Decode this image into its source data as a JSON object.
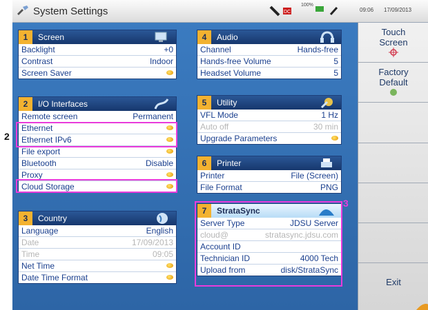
{
  "header": {
    "title": "System Settings",
    "battery_label": "100%",
    "time": "09:06",
    "date": "17/09/2013"
  },
  "callouts": {
    "left": "2",
    "right": "3"
  },
  "screen": {
    "num": "1",
    "title": "Screen",
    "rows": [
      {
        "label": "Backlight",
        "value": "+0"
      },
      {
        "label": "Contrast",
        "value": "Indoor"
      },
      {
        "label": "Screen Saver",
        "value": ""
      }
    ]
  },
  "io": {
    "num": "2",
    "title": "I/O Interfaces",
    "rows": [
      {
        "label": "Remote screen",
        "value": "Permanent"
      },
      {
        "label": "Ethernet",
        "value": ""
      },
      {
        "label": "Ethernet IPv6",
        "value": ""
      },
      {
        "label": "File export",
        "value": ""
      },
      {
        "label": "Bluetooth",
        "value": "Disable"
      },
      {
        "label": "Proxy",
        "value": ""
      },
      {
        "label": "Cloud Storage",
        "value": ""
      }
    ]
  },
  "country": {
    "num": "3",
    "title": "Country",
    "rows": [
      {
        "label": "Language",
        "value": "English"
      },
      {
        "label": "Date",
        "value": "17/09/2013"
      },
      {
        "label": "Time",
        "value": "09:05"
      },
      {
        "label": "Net Time",
        "value": ""
      },
      {
        "label": "Date Time Format",
        "value": ""
      }
    ]
  },
  "audio": {
    "num": "4",
    "title": "Audio",
    "rows": [
      {
        "label": "Channel",
        "value": "Hands-free"
      },
      {
        "label": "Hands-free Volume",
        "value": "5"
      },
      {
        "label": "Headset Volume",
        "value": "5"
      }
    ]
  },
  "utility": {
    "num": "5",
    "title": "Utility",
    "rows": [
      {
        "label": "VFL Mode",
        "value": "1 Hz"
      },
      {
        "label": "Auto off",
        "value": "30 min"
      },
      {
        "label": "Upgrade Parameters",
        "value": ""
      }
    ]
  },
  "printer": {
    "num": "6",
    "title": "Printer",
    "rows": [
      {
        "label": "Printer",
        "value": "File (Screen)"
      },
      {
        "label": "File Format",
        "value": "PNG"
      }
    ]
  },
  "stratasync": {
    "num": "7",
    "title": "StrataSync",
    "rows": [
      {
        "label": "Server Type",
        "value": "JDSU Server"
      },
      {
        "label": "cloud@",
        "value": "stratasync.jdsu.com"
      },
      {
        "label": "Account ID",
        "value": ""
      },
      {
        "label": "Technician ID",
        "value": "4000 Tech"
      },
      {
        "label": "Upload from",
        "value": "disk/StrataSync"
      }
    ]
  },
  "sidebar": {
    "touch_screen_1": "Touch",
    "touch_screen_2": "Screen",
    "factory_default_1": "Factory",
    "factory_default_2": "Default",
    "exit": "Exit"
  },
  "colors": {
    "highlight": "#e93bdb",
    "panel_header": "#17376d",
    "accent_orange": "#f3b230"
  }
}
